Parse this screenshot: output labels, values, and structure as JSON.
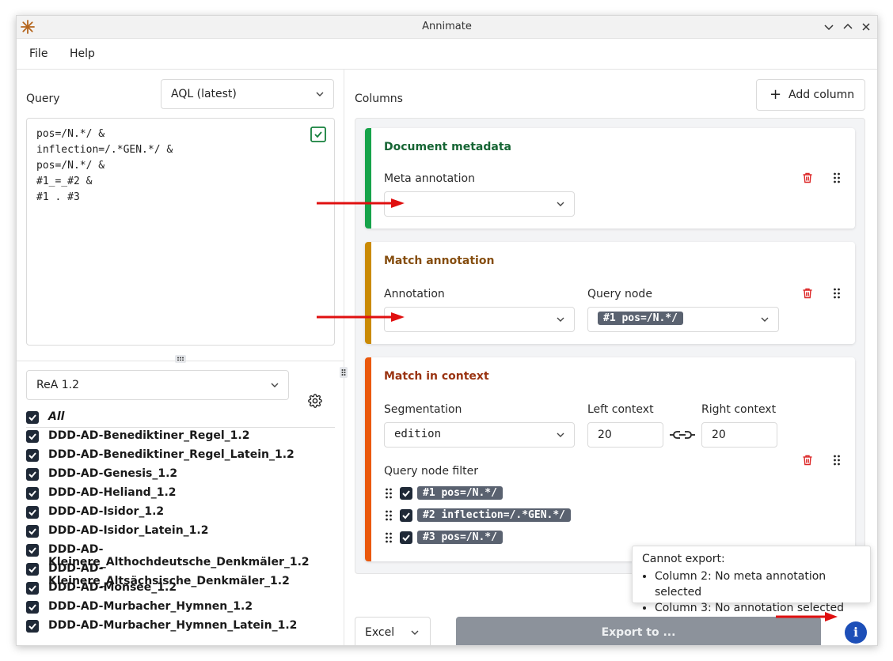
{
  "window": {
    "title": "Annimate"
  },
  "menu": [
    {
      "label": "File"
    },
    {
      "label": "Help"
    }
  ],
  "query": {
    "label": "Query",
    "language": "AQL (latest)",
    "lines": [
      "pos=/N.*/ &",
      "inflection=/.*GEN.*/ &",
      "pos=/N.*/ &",
      "#1_=_#2 &",
      "#1 . #3"
    ]
  },
  "corpus_set": {
    "selected": "ReA 1.2"
  },
  "corpora": {
    "all_label": "All",
    "items": [
      "DDD-AD-Benediktiner_Regel_1.2",
      "DDD-AD-Benediktiner_Regel_Latein_1.2",
      "DDD-AD-Genesis_1.2",
      "DDD-AD-Heliand_1.2",
      "DDD-AD-Isidor_1.2",
      "DDD-AD-Isidor_Latein_1.2",
      "DDD-AD-Kleinere_Althochdeutsche_Denkmäler_1.2",
      "DDD-AD-Kleinere_Altsächsische_Denkmäler_1.2",
      "DDD-AD-Monsee_1.2",
      "DDD-AD-Murbacher_Hymnen_1.2",
      "DDD-AD-Murbacher_Hymnen_Latein_1.2"
    ]
  },
  "columns": {
    "label": "Columns",
    "add_label": "Add column",
    "doc_meta": {
      "title": "Document metadata",
      "field_label": "Meta annotation",
      "value": "",
      "color": "#16a34a"
    },
    "match_ann": {
      "title": "Match annotation",
      "ann_label": "Annotation",
      "ann_value": "",
      "node_label": "Query node",
      "node_value": "#1 pos=/N.*/",
      "color": "#ca8a04"
    },
    "match_ctx": {
      "title": "Match in context",
      "seg_label": "Segmentation",
      "seg_value": "edition",
      "left_label": "Left context",
      "left_value": "20",
      "right_label": "Right context",
      "right_value": "20",
      "filter_label": "Query node filter",
      "filters": [
        "#1 pos=/N.*/",
        "#2 inflection=/.*GEN.*/",
        "#3 pos=/N.*/"
      ],
      "color": "#ea580c"
    }
  },
  "export": {
    "format": "Excel",
    "button": "Export to ..."
  },
  "tooltip": {
    "heading": "Cannot export:",
    "items": [
      "Column 2: No meta annotation selected",
      "Column 3: No annotation selected"
    ]
  },
  "colors": {
    "accent_info": "#1d4fb8",
    "delete": "#dc2626",
    "annotation_arrow": "#e01010"
  }
}
